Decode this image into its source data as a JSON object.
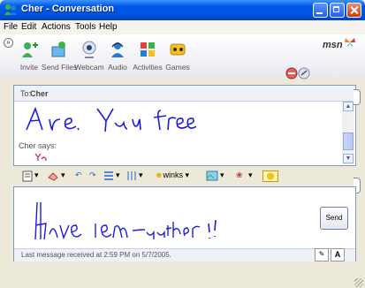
{
  "window": {
    "title": "Cher - Conversation"
  },
  "menu": [
    "File",
    "Edit",
    "Actions",
    "Tools",
    "Help"
  ],
  "toolbar": {
    "items": [
      {
        "label": "Invite",
        "icon": "invite-icon"
      },
      {
        "label": "Send Files",
        "icon": "send-files-icon"
      },
      {
        "label": "Webcam",
        "icon": "webcam-icon"
      },
      {
        "label": "Audio",
        "icon": "audio-icon"
      },
      {
        "label": "Activities",
        "icon": "activities-icon"
      },
      {
        "label": "Games",
        "icon": "games-icon"
      }
    ],
    "brand": "msn"
  },
  "conversation": {
    "to_label": "To:",
    "contact": "Cher",
    "ink_message": "Are You free",
    "says": "Cher says:",
    "says_ink": "Ya"
  },
  "compose_toolbar": {
    "winks_label": "winks"
  },
  "compose": {
    "ink_message": "have lem -- uther !!",
    "send_label": "Send",
    "last_message": "Last message received at 2:59 PM on 5/7/2005.",
    "pen_label": "✎",
    "text_label": "A"
  },
  "colors": {
    "ink": "#1c1ce0",
    "accent": "#0054e3"
  }
}
